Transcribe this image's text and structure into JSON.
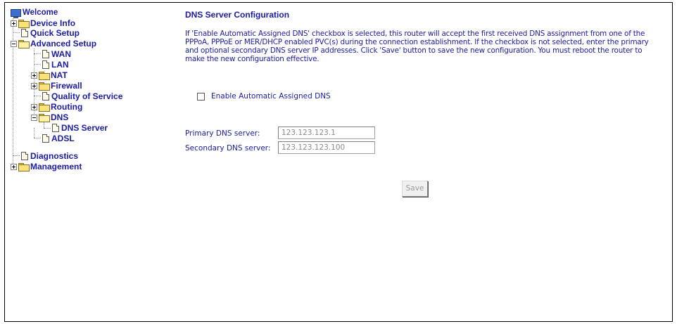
{
  "sidebar": {
    "root": {
      "label": "Welcome",
      "icon": "monitor-icon"
    },
    "items": [
      {
        "label": "Device Info",
        "expander": "plus",
        "icon": "folder-icon"
      },
      {
        "label": "Quick Setup",
        "icon": "page-icon"
      },
      {
        "label": "Advanced Setup",
        "expander": "minus",
        "icon": "open-folder-icon"
      },
      {
        "label": "WAN",
        "icon": "page-icon"
      },
      {
        "label": "LAN",
        "icon": "page-icon"
      },
      {
        "label": "NAT",
        "expander": "plus",
        "icon": "folder-icon"
      },
      {
        "label": "Firewall",
        "expander": "plus",
        "icon": "folder-icon"
      },
      {
        "label": "Quality of Service",
        "icon": "page-icon"
      },
      {
        "label": "Routing",
        "expander": "plus",
        "icon": "folder-icon"
      },
      {
        "label": "DNS",
        "expander": "minus",
        "icon": "open-folder-icon"
      },
      {
        "label": "DNS Server",
        "icon": "page-icon"
      },
      {
        "label": "ADSL",
        "icon": "page-icon"
      },
      {
        "label": "Diagnostics",
        "icon": "page-icon"
      },
      {
        "label": "Management",
        "expander": "plus",
        "icon": "folder-icon"
      }
    ]
  },
  "main": {
    "title": "DNS Server Configuration",
    "description": "If 'Enable Automatic Assigned DNS' checkbox is selected, this router will accept the first received DNS assignment from one of the PPPoA, PPPoE or MER/DHCP enabled PVC(s) during the connection establishment. If the checkbox is not selected, enter the primary and optional secondary DNS server IP addresses. Click 'Save' button to save the new configuration. You must reboot the router to make the new configuration effective.",
    "auto_dns": {
      "label": "Enable Automatic Assigned DNS",
      "checked": false
    },
    "primary": {
      "label": "Primary DNS server:",
      "value": "123.123.123.1"
    },
    "secondary": {
      "label": "Secondary DNS server:",
      "value": "123.123.123.100"
    },
    "save_label": "Save"
  },
  "colors": {
    "link_blue": "#1a1aa8",
    "text_blue": "#1a1aa8",
    "folder_yellow": "#f8e27a"
  }
}
